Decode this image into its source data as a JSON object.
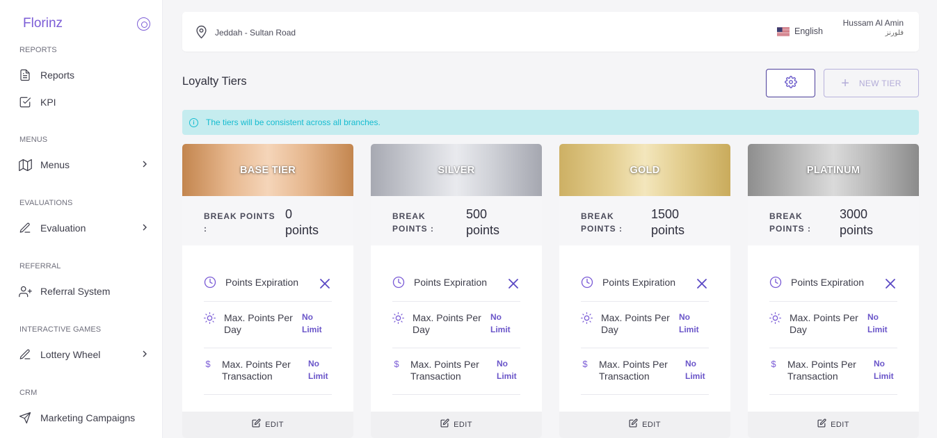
{
  "sidebar": {
    "brand": "Florinz",
    "sections": {
      "reports": "REPORTS",
      "menus": "MENUS",
      "evaluations": "EVALUATIONS",
      "referral": "REFERRAL",
      "games": "INTERACTIVE GAMES",
      "crm": "CRM"
    },
    "items": {
      "reports": "Reports",
      "kpi": "KPI",
      "menus": "Menus",
      "evaluation": "Evaluation",
      "referral": "Referral System",
      "lottery": "Lottery Wheel",
      "marketing": "Marketing Campaigns"
    }
  },
  "topbar": {
    "location": "Jeddah - Sultan Road",
    "language": "English",
    "user_name": "Hussam Al Amin",
    "user_sub": "فلورنز"
  },
  "header": {
    "title": "Loyalty Tiers",
    "new_tier": "NEW TIER"
  },
  "alert": {
    "message": "The tiers will be consistent across all branches."
  },
  "tiers": [
    {
      "name": "BASE TIER",
      "break_label_1": "BREAK POINTS",
      "break_label_2": ":",
      "break_value_1": "0",
      "break_value_2": "points",
      "expiration": "Points Expiration",
      "per_day_1": "Max. Points Per",
      "per_day_2": "Day",
      "per_day_val_1": "No",
      "per_day_val_2": "Limit",
      "per_tx_1": "Max. Points Per",
      "per_tx_2": "Transaction",
      "per_tx_val_1": "No",
      "per_tx_val_2": "Limit",
      "edit": "EDIT"
    },
    {
      "name": "SILVER",
      "break_label_1": "BREAK",
      "break_label_2": "POINTS :",
      "break_value_1": "500",
      "break_value_2": "points",
      "expiration": "Points Expiration",
      "per_day_1": "Max. Points Per",
      "per_day_2": "Day",
      "per_day_val_1": "No",
      "per_day_val_2": "Limit",
      "per_tx_1": "Max. Points Per",
      "per_tx_2": "Transaction",
      "per_tx_val_1": "No",
      "per_tx_val_2": "Limit",
      "edit": "EDIT"
    },
    {
      "name": "GOLD",
      "break_label_1": "BREAK",
      "break_label_2": "POINTS :",
      "break_value_1": "1500",
      "break_value_2": "points",
      "expiration": "Points Expiration",
      "per_day_1": "Max. Points Per",
      "per_day_2": "Day",
      "per_day_val_1": "No",
      "per_day_val_2": "Limit",
      "per_tx_1": "Max. Points Per",
      "per_tx_2": "Transaction",
      "per_tx_val_1": "No",
      "per_tx_val_2": "Limit",
      "edit": "EDIT"
    },
    {
      "name": "PLATINUM",
      "break_label_1": "BREAK",
      "break_label_2": "POINTS :",
      "break_value_1": "3000",
      "break_value_2": "points",
      "expiration": "Points Expiration",
      "per_day_1": "Max. Points Per",
      "per_day_2": "Day",
      "per_day_val_1": "No",
      "per_day_val_2": "Limit",
      "per_tx_1": "Max. Points Per",
      "per_tx_2": "Transaction",
      "per_tx_val_1": "No",
      "per_tx_val_2": "Limit",
      "edit": "EDIT"
    }
  ],
  "colors": {
    "accent": "#7b5cd6",
    "dark_accent": "#4b3d9a",
    "alert_bg": "#c5ecef",
    "alert_text": "#16bcd0",
    "bronze": "#c98d58",
    "silver": "#b3b5bd",
    "gold": "#d6bd6e",
    "platinum": "#9d9d9d"
  }
}
